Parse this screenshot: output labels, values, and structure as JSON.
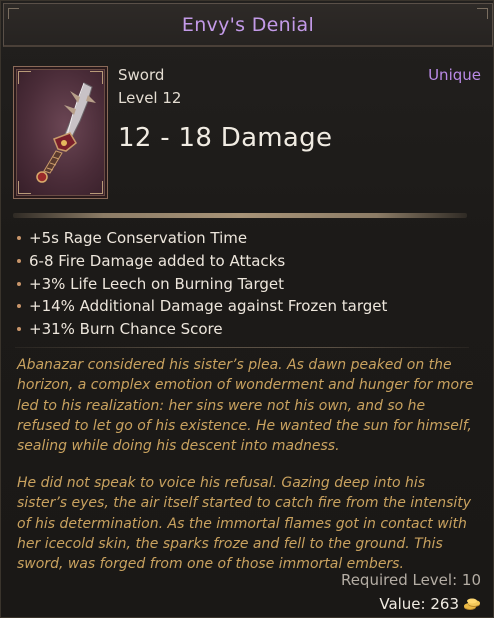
{
  "tooltip": {
    "name": "Envy's Denial",
    "name_color": "#c39ae8",
    "rarity": "Unique",
    "rarity_color": "#b98ae6",
    "type": "Sword",
    "level_text": "Level 12",
    "damage_text": "12 - 18 Damage",
    "item_icon": "sword-icon",
    "modifiers": [
      "+5s Rage Conservation Time",
      "6-8 Fire Damage added to Attacks",
      "+3% Life Leech on Burning Target",
      "+14% Additional Damage against Frozen target",
      "+31% Burn Chance Score"
    ],
    "lore": [
      "Abanazar considered his sister’s plea. As dawn peaked on the horizon, a complex emotion of wonderment and hunger for more led to his realization: her sins were not his own, and so he refused to let go of his existence. He wanted the sun for himself, sealing while doing his descent into madness.",
      "He did not speak to voice his refusal. Gazing deep into his sister’s eyes, the air itself started to catch fire from the intensity of his determination. As the immortal flames got in contact with her icecold skin, the sparks froze and fell to the ground. This sword, was forged from one of those immortal embers."
    ],
    "lore_color": "#c9a25f",
    "required_level_text": "Required Level: 10",
    "value_text": "Value: 263",
    "currency_icon": "gold-coins-icon"
  }
}
